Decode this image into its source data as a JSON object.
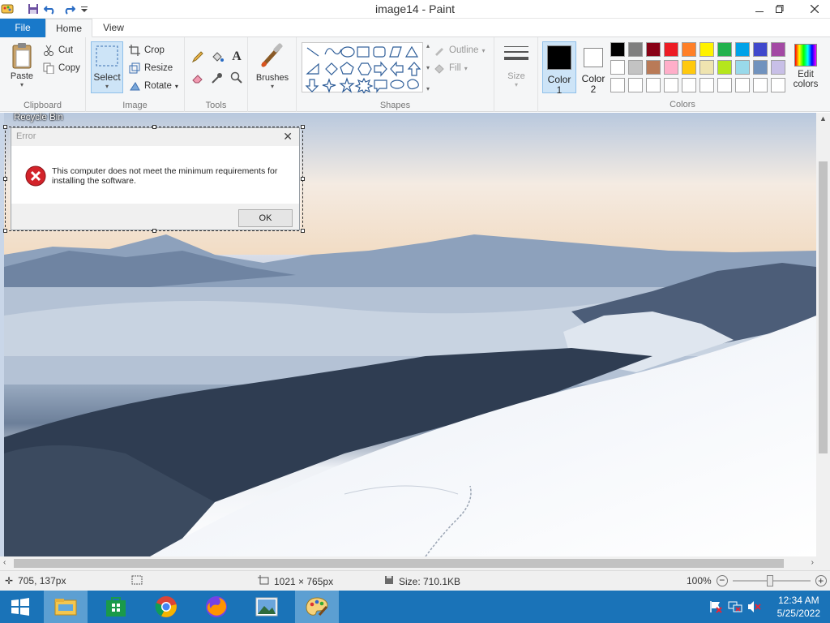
{
  "window": {
    "title": "image14 - Paint",
    "controls": [
      "minimize",
      "maximize",
      "close"
    ]
  },
  "quick_access": [
    "paint-app-icon",
    "save-icon",
    "undo-icon",
    "redo-icon",
    "customize-icon"
  ],
  "tabs": [
    {
      "label": "File"
    },
    {
      "label": "Home"
    },
    {
      "label": "View"
    }
  ],
  "ribbon": {
    "clipboard": {
      "paste": "Paste",
      "cut": "Cut",
      "copy": "Copy",
      "label": "Clipboard"
    },
    "image": {
      "select": "Select",
      "crop": "Crop",
      "resize": "Resize",
      "rotate": "Rotate",
      "label": "Image"
    },
    "tools": {
      "label": "Tools"
    },
    "brushes": {
      "label": "Brushes"
    },
    "shapes": {
      "outline": "Outline",
      "fill": "Fill",
      "label": "Shapes"
    },
    "size": {
      "label": "Size"
    },
    "color1": {
      "line1": "Color",
      "line2": "1",
      "value": "#000000"
    },
    "color2": {
      "line1": "Color",
      "line2": "2",
      "value": "#ffffff"
    },
    "colors": {
      "label": "Colors"
    },
    "edit_colors": {
      "line1": "Edit",
      "line2": "colors"
    }
  },
  "palette": [
    [
      "#000000",
      "#7f7f7f",
      "#880015",
      "#ed1c24",
      "#ff7f27",
      "#fff200",
      "#22b14c",
      "#00a2e8",
      "#3f48cc",
      "#a349a4"
    ],
    [
      "#ffffff",
      "#c3c3c3",
      "#b97a57",
      "#ffaec9",
      "#ffc90e",
      "#efe4b0",
      "#b5e61d",
      "#99d9ea",
      "#7092be",
      "#c8bfe7"
    ],
    [
      "#ffffff",
      "#ffffff",
      "#ffffff",
      "#ffffff",
      "#ffffff",
      "#ffffff",
      "#ffffff",
      "#ffffff",
      "#ffffff",
      "#ffffff"
    ]
  ],
  "canvas": {
    "recycle_bin": "Recycle Bin",
    "dialog": {
      "title": "Error",
      "message": "This computer does not meet the minimum requirements for installing the software.",
      "ok": "OK"
    }
  },
  "status": {
    "cursor": "705, 137px",
    "dimensions": "1021 × 765px",
    "size": "Size: 710.1KB",
    "zoom": "100%"
  },
  "taskbar": {
    "apps": [
      "start-button",
      "file-explorer",
      "store",
      "chrome",
      "firefox",
      "photos",
      "paint"
    ],
    "time": "12:34 AM",
    "date": "5/25/2022"
  }
}
